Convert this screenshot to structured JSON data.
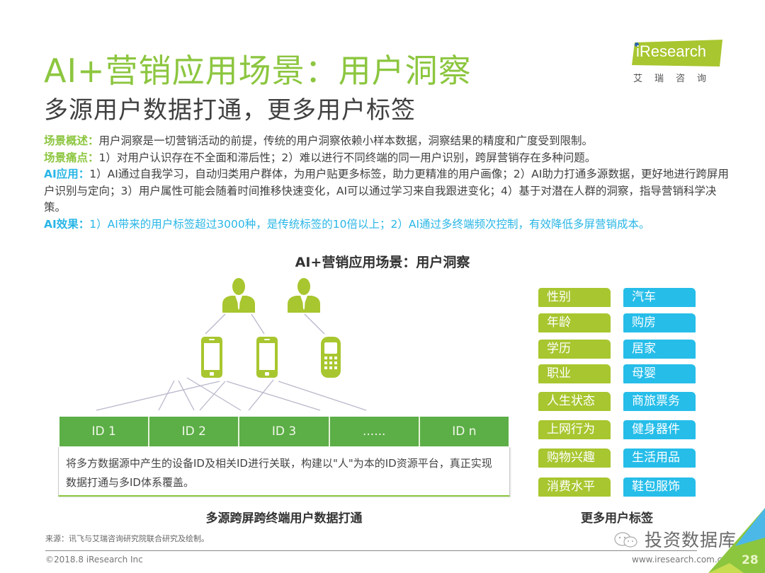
{
  "header": {
    "title": "AI+营销应用场景：用户洞察",
    "subtitle": "多源用户数据打通，更多用户标签"
  },
  "logo": {
    "brand": "iResearch",
    "brand_cn": "艾瑞咨询",
    "brand_color": "#a8c62f"
  },
  "description": {
    "overview_label": "场景概述：",
    "overview_text": "用户洞察是一切营销活动的前提，传统的用户洞察依赖小样本数据，洞察结果的精度和广度受到限制。",
    "pain_label": "场景痛点：",
    "pain_text": "1）对用户认识存在不全面和滞后性；2）难以进行不同终端的同一用户识别，跨屏营销存在多种问题。",
    "app_label": "AI应用：",
    "app_text": "1）AI通过自我学习，自动归类用户群体，为用户贴更多标签，助力更精准的用户画像；2）AI助力打通多源数据，更好地进行跨屏用户识别与定向；3）用户属性可能会随着时间推移快速变化，AI可以通过学习来自我跟进变化；4）基于对潜在人群的洞察，指导营销科学决策。",
    "effect_label": "AI效果：",
    "effect_text": "1）AI带来的用户标签超过3000种，是传统标签的10倍以上；2）AI通过多终端频次控制，有效降低多屏营销成本。"
  },
  "diagram": {
    "title": "AI+营销应用场景：用户洞察",
    "people_icons": [
      "person-icon",
      "person-icon"
    ],
    "device_icons": [
      "smartphone-icon",
      "smartphone-icon",
      "feature-phone-icon"
    ],
    "ids": [
      "ID 1",
      "ID 2",
      "ID 3",
      "......",
      "ID n"
    ],
    "id_description": "将多方数据源中产生的设备ID及相关ID进行关联，构建以\"人\"为本的ID资源平台，真正实现数据打通与多ID体系覆盖。",
    "caption_left": "多源跨屏跨终端用户数据打通",
    "caption_right": "更多用户标签",
    "tags_left": [
      "性别",
      "年龄",
      "学历",
      "职业",
      "人生状态",
      "上网行为",
      "购物兴趣",
      "消费水平"
    ],
    "tags_right": [
      "汽车",
      "购房",
      "居家",
      "母婴",
      "商旅票务",
      "健身器件",
      "生活用品",
      "鞋包服饰"
    ],
    "colors": {
      "icon_green": "#a8c62f",
      "id_bar_green": "#5cae47",
      "tag_green": "#a8c62f",
      "tag_blue": "#26bde9"
    }
  },
  "footer": {
    "source": "来源：讯飞与艾瑞咨询研究院联合研究及绘制。",
    "copyright": "©2018.8 iResearch Inc",
    "website": "www.iresearch.com.cn",
    "page_number": "28",
    "watermark": "投资数据库"
  }
}
